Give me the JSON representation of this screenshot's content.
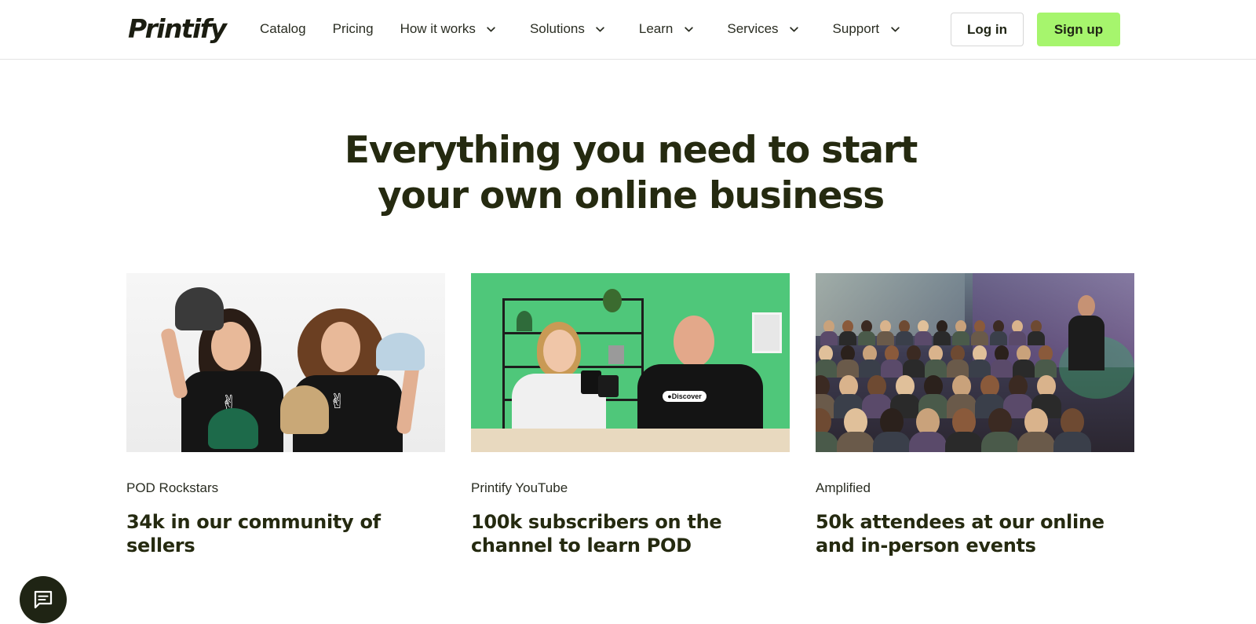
{
  "header": {
    "logo_text": "Printify",
    "nav": [
      {
        "label": "Catalog",
        "has_dropdown": false
      },
      {
        "label": "Pricing",
        "has_dropdown": false
      },
      {
        "label": "How it works",
        "has_dropdown": true
      },
      {
        "label": "Solutions",
        "has_dropdown": true
      },
      {
        "label": "Learn",
        "has_dropdown": true
      },
      {
        "label": "Services",
        "has_dropdown": true
      },
      {
        "label": "Support",
        "has_dropdown": true
      }
    ],
    "login_label": "Log in",
    "signup_label": "Sign up"
  },
  "hero": {
    "title_line1": "Everything you need to start",
    "title_line2": "your own online business"
  },
  "cards": [
    {
      "kicker": "POD Rockstars",
      "title": "34k in our community of sellers"
    },
    {
      "kicker": "Printify YouTube",
      "title": "100k subscribers on the channel to learn POD"
    },
    {
      "kicker": "Amplified",
      "title": "50k attendees at our online and in-person events"
    }
  ],
  "colors": {
    "accent_green": "#a6f56d",
    "heading_dark": "#252a10",
    "chat_bg": "#1f2414"
  },
  "icons": {
    "nav_dropdown": "chevron-down-icon",
    "chat": "chat-icon"
  }
}
